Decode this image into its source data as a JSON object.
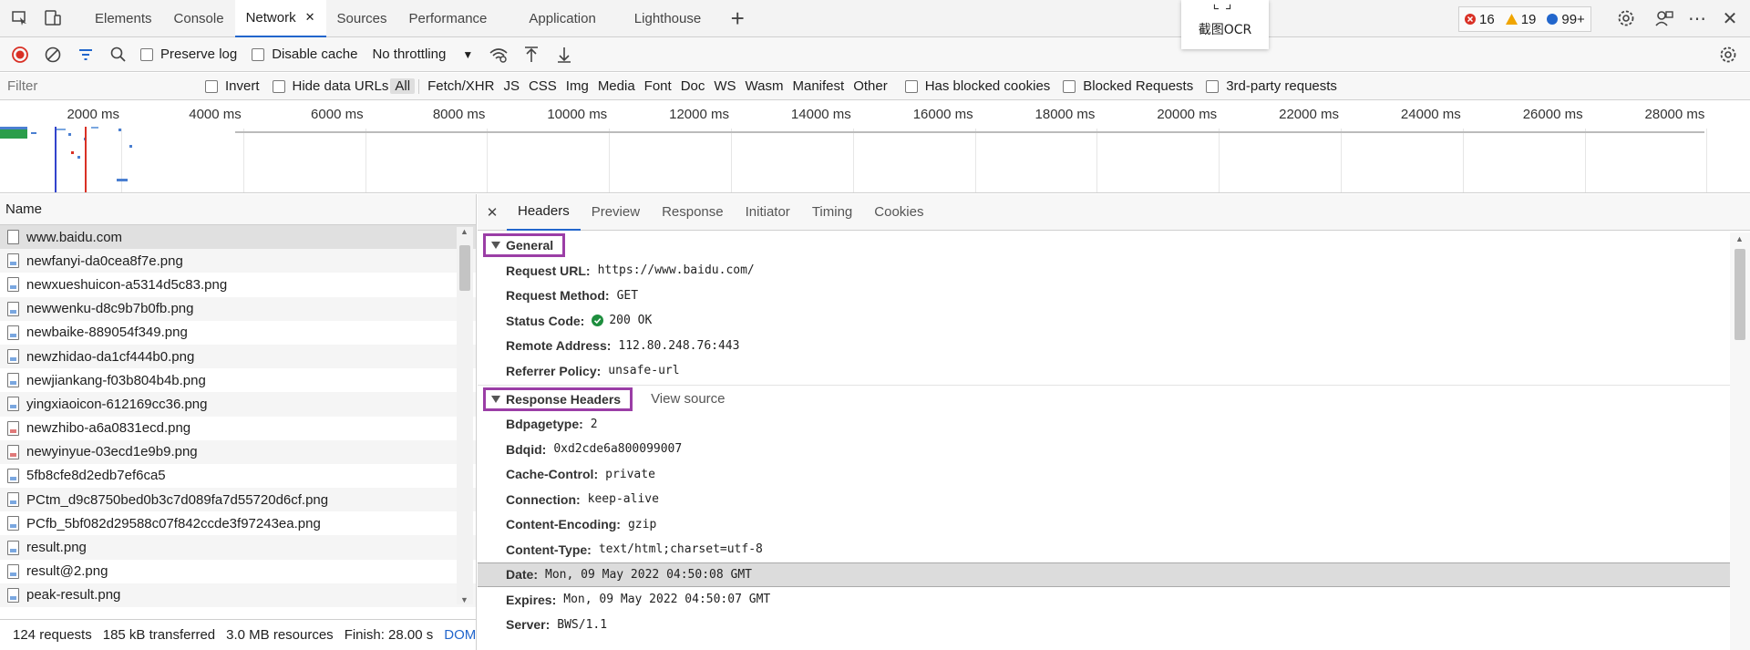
{
  "tabbar": {
    "tabs": [
      {
        "label": "Elements"
      },
      {
        "label": "Console"
      },
      {
        "label": "Network"
      },
      {
        "label": "Sources"
      },
      {
        "label": "Performance"
      },
      {
        "label": "Application"
      },
      {
        "label": "Lighthouse"
      }
    ],
    "close_glyph": "✕",
    "add_glyph": "+",
    "errors": "16",
    "warnings": "19",
    "messages": "99+"
  },
  "ocr_popup": {
    "label": "截图OCR"
  },
  "toolbar": {
    "preserve_log": "Preserve log",
    "disable_cache": "Disable cache",
    "throttling": "No throttling"
  },
  "filterbar": {
    "filter_placeholder": "Filter",
    "invert": "Invert",
    "hide_data_urls": "Hide data URLs",
    "types": [
      "All",
      "Fetch/XHR",
      "JS",
      "CSS",
      "Img",
      "Media",
      "Font",
      "Doc",
      "WS",
      "Wasm",
      "Manifest",
      "Other"
    ],
    "has_blocked_cookies": "Has blocked cookies",
    "blocked_requests": "Blocked Requests",
    "third_party": "3rd-party requests"
  },
  "overview": {
    "ticks": [
      "2000 ms",
      "4000 ms",
      "6000 ms",
      "8000 ms",
      "10000 ms",
      "12000 ms",
      "14000 ms",
      "16000 ms",
      "18000 ms",
      "20000 ms",
      "22000 ms",
      "24000 ms",
      "26000 ms",
      "28000 ms"
    ]
  },
  "requests": {
    "header": "Name",
    "items": [
      {
        "name": "www.baidu.com",
        "icon": "document-icon"
      },
      {
        "name": "newfanyi-da0cea8f7e.png",
        "icon": "image-file-icon"
      },
      {
        "name": "newxueshuicon-a5314d5c83.png",
        "icon": "image-file-icon"
      },
      {
        "name": "newwenku-d8c9b7b0fb.png",
        "icon": "image-file-icon"
      },
      {
        "name": "newbaike-889054f349.png",
        "icon": "image-file-icon"
      },
      {
        "name": "newzhidao-da1cf444b0.png",
        "icon": "image-file-icon"
      },
      {
        "name": "newjiankang-f03b804b4b.png",
        "icon": "image-file-icon"
      },
      {
        "name": "yingxiaoicon-612169cc36.png",
        "icon": "image-file-icon"
      },
      {
        "name": "newzhibo-a6a0831ecd.png",
        "icon": "image-file-icon"
      },
      {
        "name": "newyinyue-03ecd1e9b9.png",
        "icon": "image-file-icon"
      },
      {
        "name": "5fb8cfe8d2edb7ef6ca5",
        "icon": "image-file-icon"
      },
      {
        "name": "PCtm_d9c8750bed0b3c7d089fa7d55720d6cf.png",
        "icon": "image-file-icon"
      },
      {
        "name": "PCfb_5bf082d29588c07f842ccde3f97243ea.png",
        "icon": "image-file-icon"
      },
      {
        "name": "result.png",
        "icon": "image-file-icon"
      },
      {
        "name": "result@2.png",
        "icon": "image-file-icon"
      },
      {
        "name": "peak-result.png",
        "icon": "image-file-icon"
      }
    ]
  },
  "statusbar": {
    "requests": "124 requests",
    "transferred": "185 kB transferred",
    "resources": "3.0 MB resources",
    "finish": "Finish: 28.00 s",
    "domcontent": "DOMCon"
  },
  "details": {
    "tabs": [
      "Headers",
      "Preview",
      "Response",
      "Initiator",
      "Timing",
      "Cookies"
    ],
    "general": {
      "title": "General",
      "rows": [
        {
          "k": "Request URL:",
          "v": "https://www.baidu.com/"
        },
        {
          "k": "Request Method:",
          "v": "GET"
        },
        {
          "k": "Status Code:",
          "v": "200 OK"
        },
        {
          "k": "Remote Address:",
          "v": "112.80.248.76:443"
        },
        {
          "k": "Referrer Policy:",
          "v": "unsafe-url"
        }
      ]
    },
    "response_headers": {
      "title": "Response Headers",
      "view_source": "View source",
      "rows": [
        {
          "k": "Bdpagetype:",
          "v": "2"
        },
        {
          "k": "Bdqid:",
          "v": "0xd2cde6a800099007"
        },
        {
          "k": "Cache-Control:",
          "v": "private"
        },
        {
          "k": "Connection:",
          "v": "keep-alive"
        },
        {
          "k": "Content-Encoding:",
          "v": "gzip"
        },
        {
          "k": "Content-Type:",
          "v": "text/html;charset=utf-8"
        },
        {
          "k": "Date:",
          "v": "Mon, 09 May 2022 04:50:08 GMT"
        },
        {
          "k": "Expires:",
          "v": "Mon, 09 May 2022 04:50:07 GMT"
        },
        {
          "k": "Server:",
          "v": "BWS/1.1"
        }
      ]
    }
  },
  "colors": {
    "accent": "#2266cc",
    "highlight_box": "#9b3ea6",
    "record_red": "#d93025"
  }
}
